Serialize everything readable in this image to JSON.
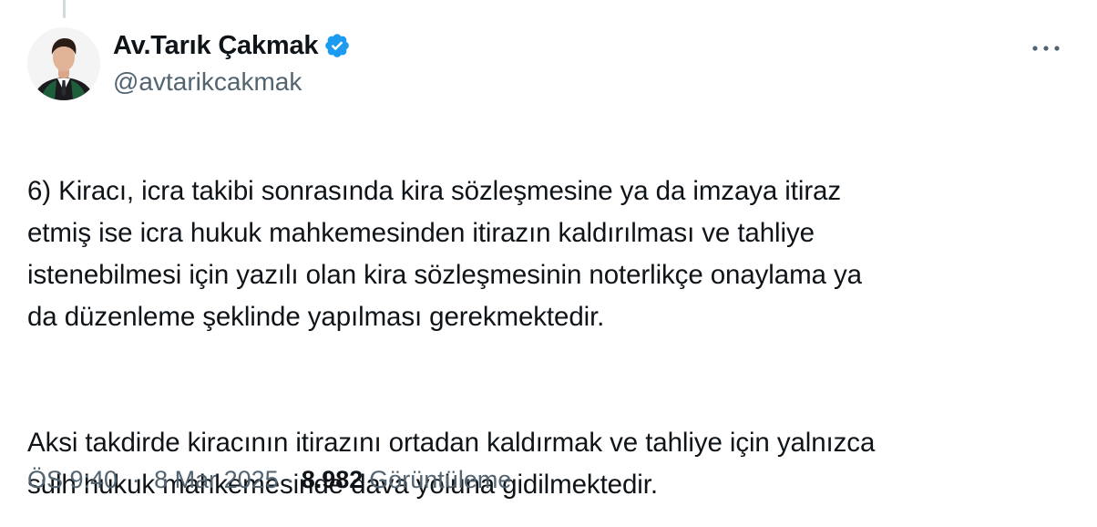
{
  "tweet": {
    "author": {
      "display_name": "Av.Tarık Çakmak",
      "handle": "@avtarikcakmak",
      "verified": true,
      "avatar_icon": "profile-photo",
      "verified_color": "#1d9bf0"
    },
    "more_icon": "more-horizontal-icon",
    "paragraphs": [
      "6) Kiracı, icra takibi sonrasında kira sözleşmesine ya da imzaya itiraz\netmiş ise icra hukuk mahkemesinden itirazın kaldırılması ve tahliye\nistenebilmesi için yazılı olan kira sözleşmesinin noterlikçe onaylama ya\nda düzenleme şeklinde yapılması gerekmektedir.",
      "Aksi takdirde kiracının itirazını ortadan kaldırmak ve tahliye için yalnızca\nsulh hukuk mahkemesinde dava yoluna gidilmektedir."
    ],
    "meta": {
      "time": "ÖS 9:40",
      "separator": "·",
      "date": "8 Mar 2025",
      "views_count": "8.982",
      "views_label": "Görüntüleme"
    }
  },
  "colors": {
    "text_primary": "#0f1419",
    "text_secondary": "#536471",
    "accent": "#1d9bf0",
    "thread_line": "#cfd9de"
  }
}
